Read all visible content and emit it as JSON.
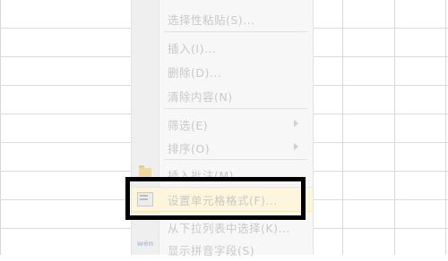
{
  "context_menu": {
    "items": [
      {
        "label": "选择性粘贴(S)..."
      },
      {
        "label": "插入(I)..."
      },
      {
        "label": "删除(D)..."
      },
      {
        "label": "清除内容(N)"
      },
      {
        "label": "筛选(E)"
      },
      {
        "label": "排序(O)"
      },
      {
        "label": "插入批注(M)"
      },
      {
        "label": "设置单元格格式(F)..."
      },
      {
        "label": "从下拉列表中选择(K)..."
      },
      {
        "label": "显示拼音字段(S)"
      }
    ],
    "icons": {
      "comment": "folder-icon",
      "format_cells": "format-cells-icon",
      "phonetic": "wen-icon",
      "phonetic_glyph": "wén"
    }
  },
  "colors": {
    "menu_text": "#c9c9c9",
    "highlight": "#fdf6dc",
    "annotation": "#000000"
  }
}
